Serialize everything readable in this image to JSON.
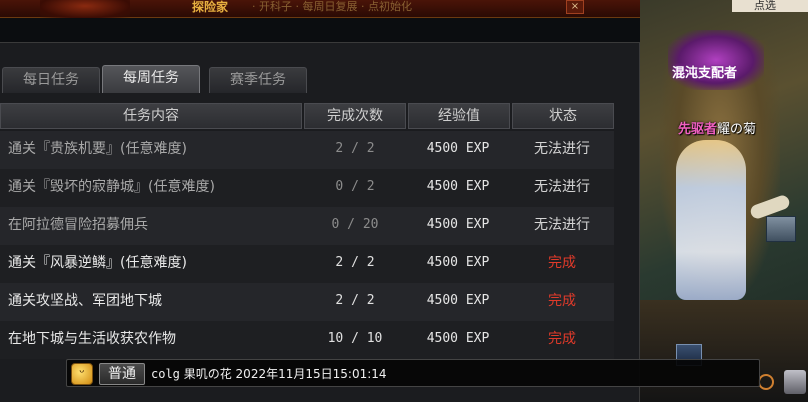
{
  "banner": {
    "title": "探险家",
    "subtitle": "· 开科子 · 每周日复展 · 点初始化",
    "close_label": "×"
  },
  "tabs": [
    {
      "label": "每日任务",
      "active": false
    },
    {
      "label": "每周任务",
      "active": true
    },
    {
      "label": "赛季任务",
      "active": false
    }
  ],
  "table": {
    "headers": [
      "任务内容",
      "完成次数",
      "经验值",
      "状态"
    ],
    "rows": [
      {
        "name": "通关『贵族机要』(任意难度)",
        "count": "2 / 2",
        "exp": "4500 EXP",
        "status": "无法进行",
        "done": false
      },
      {
        "name": "通关『毁坏的寂静城』(任意难度)",
        "count": "0 / 2",
        "exp": "4500 EXP",
        "status": "无法进行",
        "done": false
      },
      {
        "name": "在阿拉德冒险招募佣兵",
        "count": "0 / 20",
        "exp": "4500 EXP",
        "status": "无法进行",
        "done": false
      },
      {
        "name": "通关『风暴逆鳞』(任意难度)",
        "count": "2 / 2",
        "exp": "4500 EXP",
        "status": "完成",
        "done": true
      },
      {
        "name": "通关攻坚战、军团地下城",
        "count": "2 / 2",
        "exp": "4500 EXP",
        "status": "完成",
        "done": true
      },
      {
        "name": "在地下城与生活收获农作物",
        "count": "10 / 10",
        "exp": "4500 EXP",
        "status": "完成",
        "done": true
      }
    ]
  },
  "chat": {
    "emote_icon": "smile-face-icon",
    "channel": "普通",
    "sender": "colg",
    "message": "果叽の花 2022年11月15日15:01:14"
  },
  "scene": {
    "guild_name": "混沌支配者",
    "char_class": "先驱者",
    "char_name": "耀の菊",
    "top_tab": "点选"
  },
  "colors": {
    "done_status": "#e03a2a",
    "panel_bg": "#1b1c1f"
  }
}
